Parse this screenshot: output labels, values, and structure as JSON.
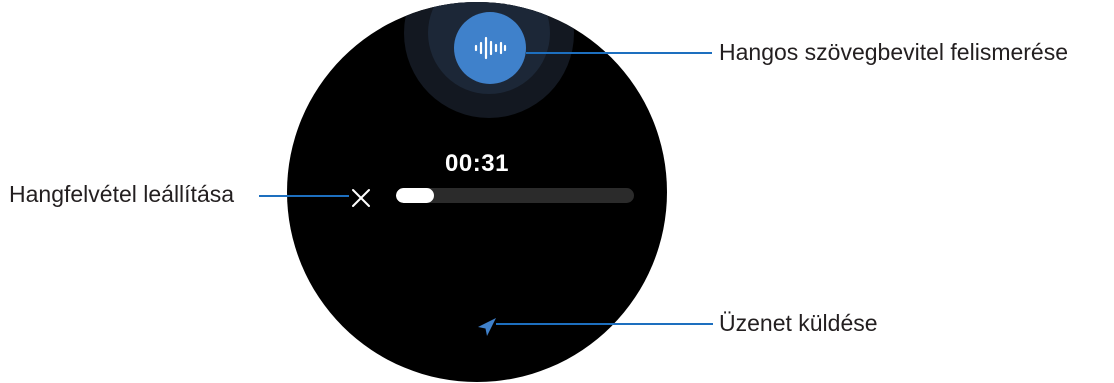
{
  "screen": {
    "timer": "00:31",
    "recording_progress": 0.16,
    "icons": {
      "voice": "voice-waveform-icon",
      "stop": "close-icon",
      "send": "send-icon"
    }
  },
  "callouts": {
    "voice_recognition": "Hangos szövegbevitel felismerése",
    "stop_recording": "Hangfelvétel leállítása",
    "send_message": "Üzenet küldése"
  },
  "colors": {
    "accent": "#3f81cb",
    "leader_line": "#1d6fbf",
    "screen_bg": "#000000"
  }
}
